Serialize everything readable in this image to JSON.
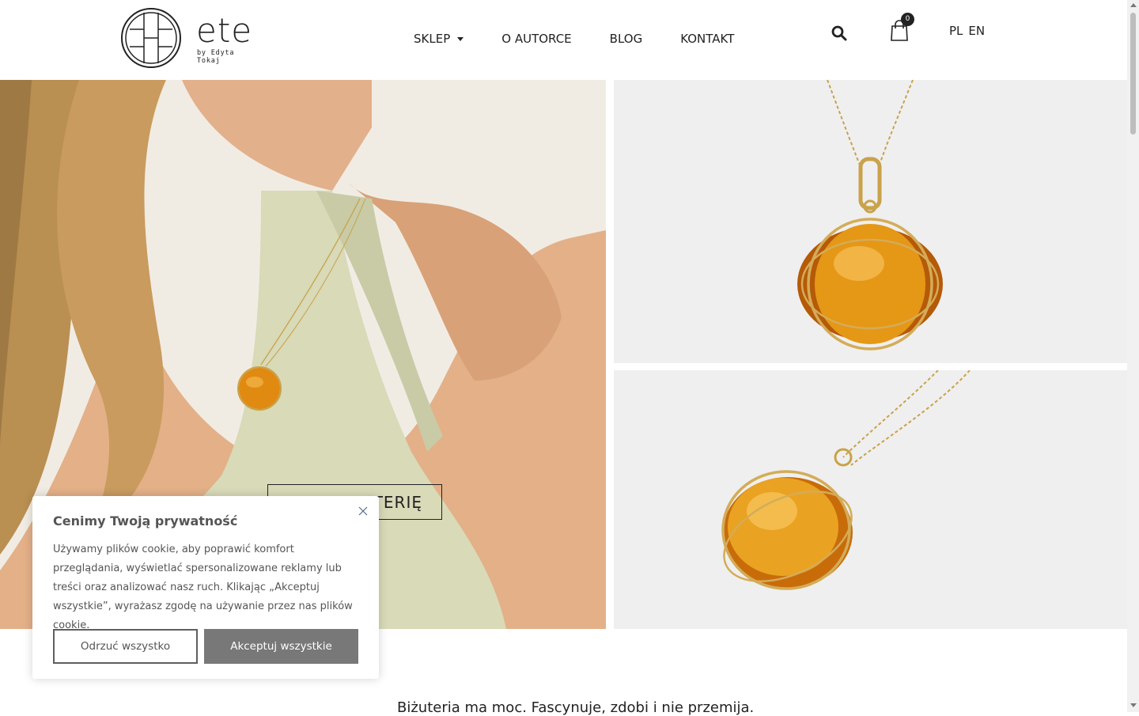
{
  "logo": {
    "name": "ete",
    "tagline": "by Edyta Tokaj"
  },
  "nav": {
    "items": [
      "SKLEP",
      "O AUTORCE",
      "BLOG",
      "KONTAKT"
    ]
  },
  "cart": {
    "count": "0"
  },
  "languages": [
    "PL",
    "EN"
  ],
  "hero": {
    "cta_label": "UTERIĘ"
  },
  "tagline": "Biżuteria ma moc. Fascynuje, zdobi i nie przemija.",
  "cookie": {
    "title": "Cenimy Twoją prywatność",
    "text": "Używamy plików cookie, aby poprawić komfort przeglądania, wyświetlać spersonalizowane reklamy lub treści oraz analizować nasz ruch. Klikając „Akceptuj wszystkie”, wyrażasz zgodę na używanie przez nas plików cookie.",
    "reject_label": "Odrzuć wszystko",
    "accept_label": "Akceptuj wszystkie"
  },
  "colors": {
    "amber": "#e08a12",
    "gold": "#c9a24a",
    "dress": "#dcdcbc",
    "accept_bg": "#787878"
  }
}
